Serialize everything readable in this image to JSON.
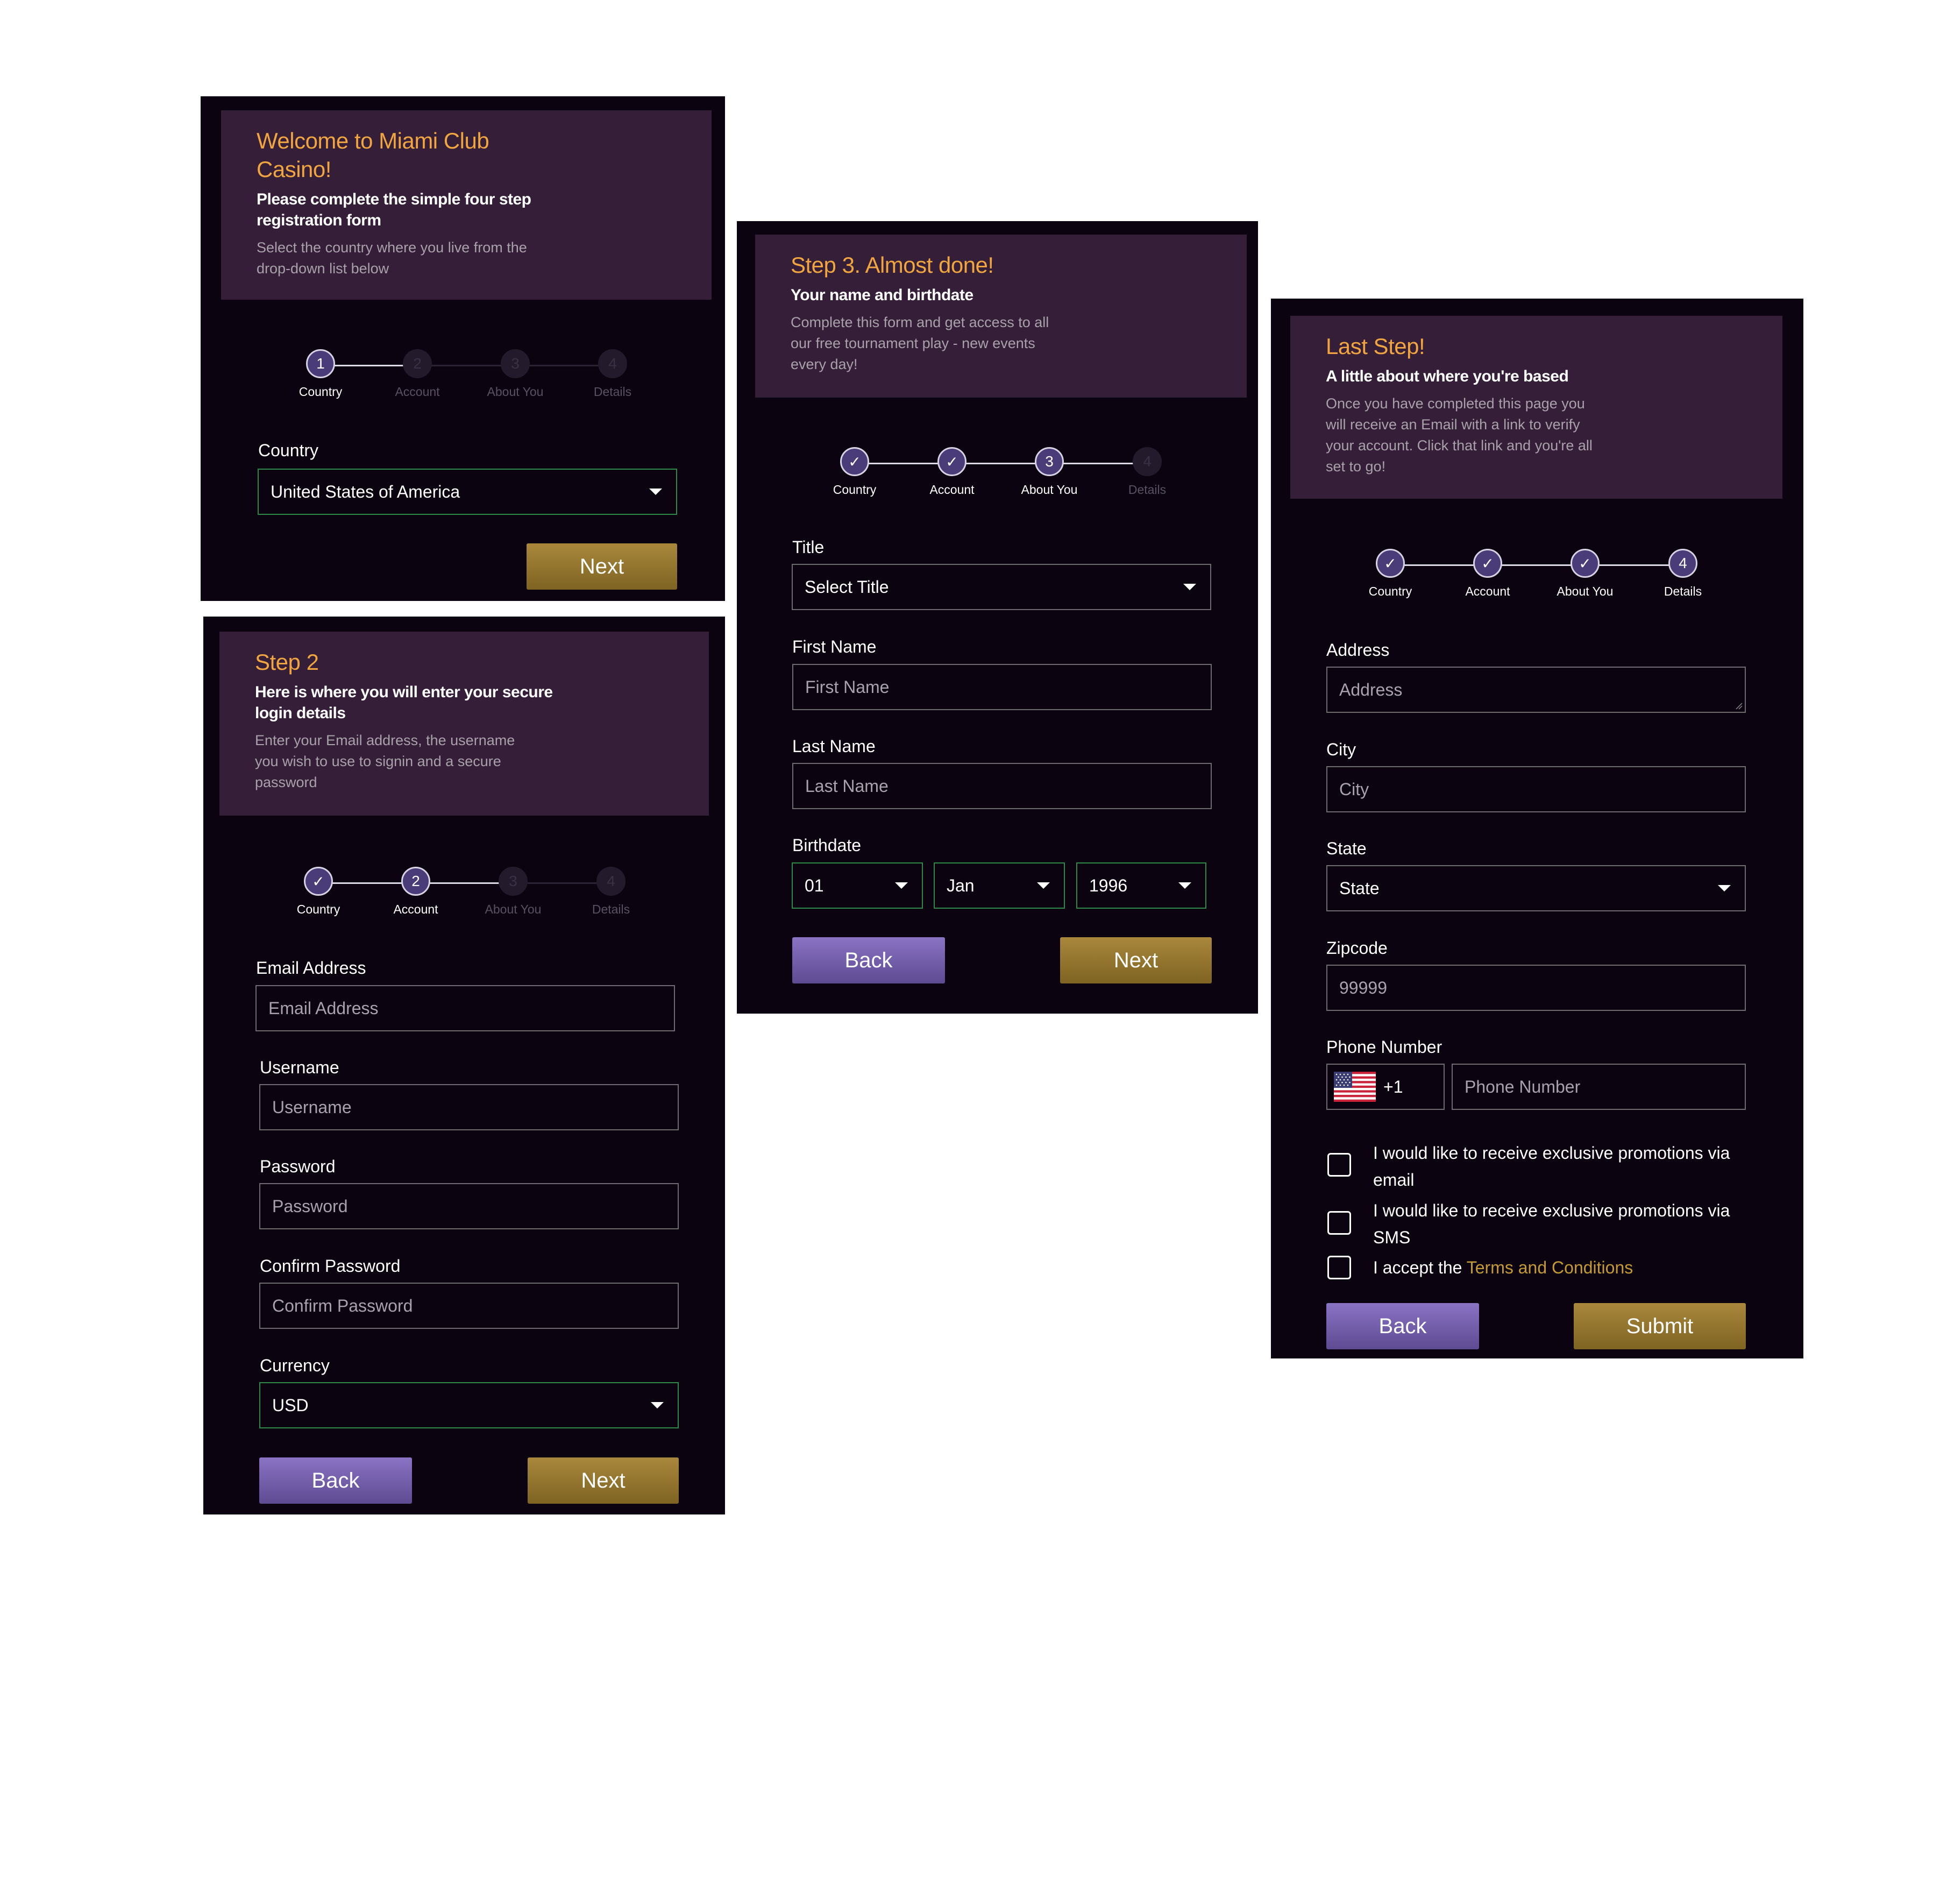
{
  "steps_labels": [
    "Country",
    "Account",
    "About You",
    "Details"
  ],
  "panel1": {
    "title": "Welcome to Miami Club Casino!",
    "title_line1": "Welcome to Miami Club",
    "title_line2": "Casino!",
    "subtitle_line1": "Please complete the simple four step",
    "subtitle_line2": "registration form",
    "desc_line1": "Select the country where you live from the",
    "desc_line2": "drop-down list below",
    "country_label": "Country",
    "country_value": "United States of America",
    "next_label": "Next"
  },
  "panel2": {
    "title": "Step 2",
    "subtitle_line1": "Here is where you will enter your secure",
    "subtitle_line2": "login details",
    "desc_line1": "Enter your Email address, the username",
    "desc_line2": "you wish to use to signin and a secure",
    "desc_line3": "password",
    "email_label": "Email Address",
    "email_placeholder": "Email Address",
    "username_label": "Username",
    "username_placeholder": "Username",
    "password_label": "Password",
    "password_placeholder": "Password",
    "confirm_label": "Confirm Password",
    "confirm_placeholder": "Confirm Password",
    "currency_label": "Currency",
    "currency_value": "USD",
    "back_label": "Back",
    "next_label": "Next"
  },
  "panel3": {
    "title": "Step 3. Almost done!",
    "subtitle": "Your name and birthdate",
    "desc_line1": "Complete this form and get access to all",
    "desc_line2": "our free tournament play - new events",
    "desc_line3": "every day!",
    "title_label": "Title",
    "title_value": "Select Title",
    "first_label": "First Name",
    "first_placeholder": "First Name",
    "last_label": "Last Name",
    "last_placeholder": "Last Name",
    "birth_label": "Birthdate",
    "birth_day": "01",
    "birth_month": "Jan",
    "birth_year": "1996",
    "back_label": "Back",
    "next_label": "Next"
  },
  "panel4": {
    "title": "Last Step!",
    "subtitle": "A little about where you're based",
    "desc_line1": "Once you have completed this page you",
    "desc_line2": "will receive an Email with a link to verify",
    "desc_line3": "your account. Click that link and you're all",
    "desc_line4": "set to go!",
    "address_label": "Address",
    "address_placeholder": "Address",
    "city_label": "City",
    "city_placeholder": "City",
    "state_label": "State",
    "state_value": "State",
    "zip_label": "Zipcode",
    "zip_placeholder": "99999",
    "phone_label": "Phone Number",
    "phone_code": "+1",
    "phone_placeholder": "Phone Number",
    "promo_email_line1": "I would like to receive exclusive promotions via",
    "promo_email_line2": "email",
    "promo_sms_line1": "I would like to receive exclusive promotions via",
    "promo_sms_line2": "SMS",
    "accept_prefix": "I accept the",
    "accept_link": "Terms and Conditions",
    "back_label": "Back",
    "submit_label": "Submit"
  },
  "colors": {
    "panel_bg": "#0b0310",
    "header_bg": "#351e37",
    "title_orange": "#f0a540",
    "gold_button": "#9c7c33",
    "purple_button": "#7663b0",
    "select_border_green": "#2f8a4a",
    "link_gold": "#c49a37"
  }
}
